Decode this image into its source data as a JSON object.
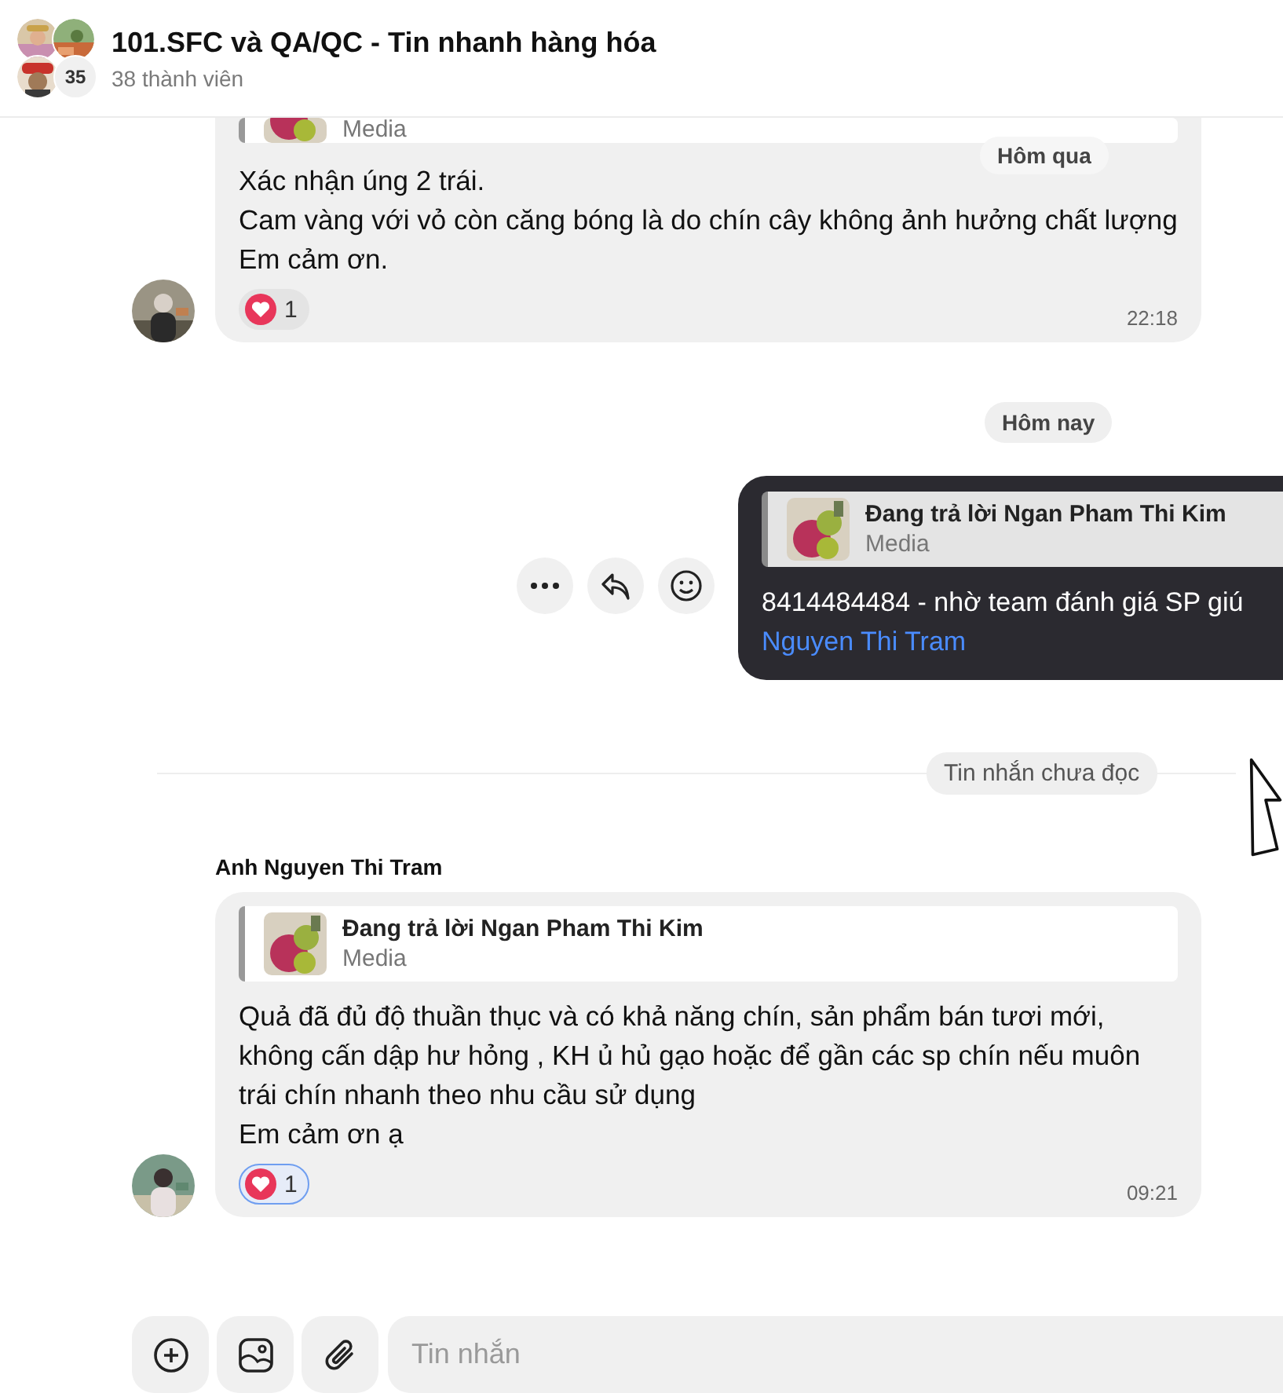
{
  "chat": {
    "title": "101.SFC và QA/QC - Tin nhanh hàng hóa",
    "member_count": "38 thành viên",
    "avatar_overflow": "35"
  },
  "sticky_date": "Hôm qua",
  "messages": [
    {
      "kind": "incoming",
      "reply": {
        "subtitle": "Media"
      },
      "paragraphs": [
        "Xác nhận úng 2 trái.",
        "Cam vàng với vỏ còn căng bóng là do chín cây không ảnh hưởng chất lượng",
        "Em cảm ơn."
      ],
      "reaction": {
        "count": "1",
        "mine": false
      },
      "time": "22:18"
    },
    {
      "kind": "date",
      "label": "Hôm nay"
    },
    {
      "kind": "outgoing",
      "reply": {
        "title": "Đang trả lời Ngan Pham Thi Kim",
        "subtitle": "Media"
      },
      "text": "8414484484 - nhờ team đánh giá SP giú",
      "mention": "Nguyen Thi Tram"
    },
    {
      "kind": "divider",
      "label": "Tin nhắn chưa đọc"
    },
    {
      "kind": "incoming",
      "sender": "Anh Nguyen Thi Tram",
      "reply": {
        "title": "Đang trả lời Ngan Pham Thi Kim",
        "subtitle": "Media"
      },
      "paragraphs": [
        "Quả đã đủ độ thuần thục và có khả năng chín, sản phẩm bán tươi mới, không cấn dập hư hỏng , KH ủ hủ gạo hoặc để gần các sp chín nếu muôn trái chín nhanh theo nhu cầu sử dụng",
        "Em cảm ơn ạ"
      ],
      "reaction": {
        "count": "1",
        "mine": true
      },
      "time": "09:21"
    }
  ],
  "composer": {
    "placeholder": "Tin nhắn"
  }
}
